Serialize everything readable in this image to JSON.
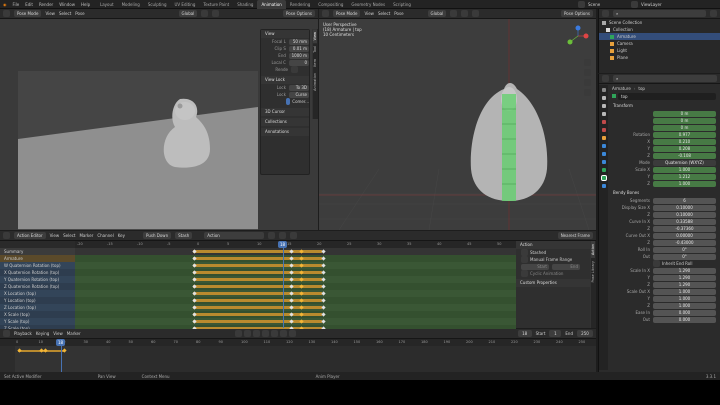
{
  "menu": [
    "File",
    "Edit",
    "Render",
    "Window",
    "Help"
  ],
  "workspaces": [
    "Layout",
    "Modeling",
    "Sculpting",
    "UV Editing",
    "Texture Paint",
    "Shading",
    "Animation",
    "Rendering",
    "Compositing",
    "Geometry Nodes",
    "Scripting"
  ],
  "active_workspace": "Animation",
  "scene": {
    "name": "Scene",
    "view_layer": "ViewLayer"
  },
  "left_view": {
    "mode": "Pose Mode",
    "view": "View",
    "select": "Select",
    "pose": "Pose",
    "global": "Global",
    "options": "Pose Options",
    "npanel": {
      "view_title": "View",
      "focal_label": "Focal L",
      "focal_value": "50 mm",
      "clip_label": "Clip S",
      "clip_value": "0.01 m",
      "end_label": "End",
      "end_value": "1000 m",
      "local_label": "Local C",
      "local_value": "0",
      "render_region": "Rende",
      "view_lock_title": "View Lock",
      "lock_label": "Lock",
      "lock_value": "To 3D",
      "lock2_label": "Lock",
      "lock2_value": "Curse",
      "comer": "Comer...",
      "cursor": "3D Cursor",
      "collections": "Collections",
      "annotations": "Annotations"
    },
    "tabs": [
      "View",
      "Tool",
      "Item",
      "Animation"
    ]
  },
  "right_view": {
    "mode": "Pose Mode",
    "view": "View",
    "select": "Select",
    "pose": "Pose",
    "global": "Global",
    "options": "Pose Options",
    "info_line1": "User Perspective",
    "info_line2": "(18) Armature | top",
    "info_line3": "10 Centimeters"
  },
  "outliner": {
    "items": [
      {
        "label": "Scene Collection",
        "kind": "root"
      },
      {
        "label": "Collection",
        "kind": "coll"
      },
      {
        "label": "Armature",
        "kind": "arm"
      },
      {
        "label": "Camera",
        "kind": "cam"
      },
      {
        "label": "Light",
        "kind": "light"
      },
      {
        "label": "Plane",
        "kind": "mesh"
      }
    ]
  },
  "properties": {
    "breadcrumb1": "Armature",
    "breadcrumb2": "top",
    "bone": "top",
    "transform": "Transform",
    "location_x": "0 m",
    "location_y": "0 m",
    "location_z": "0 m",
    "rotation_label": "Rotation",
    "rot_w": "0.977",
    "rot_x": "0.210",
    "rot_y": "0.208",
    "rot_z": "-0.108",
    "mode_label": "Mode",
    "mode_value": "Quaternion (WXYZ)",
    "scale_label": "Scale X",
    "scale_x": "1.000",
    "scale_y": "1.212",
    "scale_z": "1.000",
    "bendy": "Bendy Bones",
    "segments_label": "Segments",
    "segments": "6",
    "display_size_label": "Display Size X",
    "dsx": "0.10000",
    "dsz": "0.10000",
    "curve_in_label": "Curve In X",
    "cix": "0.33588",
    "ciz": "-0.37360",
    "curve_out_label": "Curve Out X",
    "cox": "0.00000",
    "coz": "-0.43000",
    "roll_in_label": "Roll In",
    "roll_in": "0°",
    "roll_out_label": "Out",
    "roll_out": "0°",
    "inherit": "Inherit End Roll",
    "scale_in_label": "Scale In X",
    "six": "1.290",
    "siy": "1.290",
    "siz": "1.290",
    "scale_out_label": "Scale Out X",
    "sox": "1.000",
    "soy": "1.000",
    "soz": "1.000",
    "ease_in_label": "Ease In",
    "ease_in": "0.000",
    "ease_out_label": "Out",
    "ease_out": "0.000"
  },
  "action_editor": {
    "mode": "Action Editor",
    "view": "View",
    "select": "Select",
    "marker": "Marker",
    "channel": "Channel",
    "key": "Key",
    "push_down": "Push Down",
    "stash": "Stash",
    "action_name": "Action",
    "nearest": "Nearest Frame",
    "current_frame": "18",
    "channels": [
      {
        "label": "Summary",
        "kind": "sum"
      },
      {
        "label": "Armature",
        "kind": "obj"
      },
      {
        "label": "W Quaternion Rotation (top)",
        "kind": "ch"
      },
      {
        "label": "X Quaternion Rotation (top)",
        "kind": "ch"
      },
      {
        "label": "Y Quaternion Rotation (top)",
        "kind": "ch"
      },
      {
        "label": "Z Quaternion Rotation (top)",
        "kind": "ch"
      },
      {
        "label": "X Location (top)",
        "kind": "ch"
      },
      {
        "label": "Y Location (top)",
        "kind": "ch"
      },
      {
        "label": "Z Location (top)",
        "kind": "ch"
      },
      {
        "label": "X Scale (top)",
        "kind": "ch"
      },
      {
        "label": "Y Scale (top)",
        "kind": "ch"
      },
      {
        "label": "Z Scale (top)",
        "kind": "ch"
      }
    ],
    "ruler": [
      "-20",
      "-15",
      "-10",
      "-5",
      "0",
      "5",
      "10",
      "15",
      "20",
      "25",
      "30",
      "35",
      "40",
      "45",
      "50"
    ],
    "side": {
      "title": "Action",
      "stashed": "Stashed",
      "manual": "Manual Frame Range",
      "start": "Start",
      "end": "End",
      "cyclic": "Cyclic Animation",
      "custom": "Custom Properties"
    },
    "side_tabs": [
      "Action",
      "Pose Library"
    ]
  },
  "timeline": {
    "playback": "Playback",
    "keying": "Keying",
    "view": "View",
    "marker": "Marker",
    "start_label": "Start",
    "start": "1",
    "end_label": "End",
    "end": "250",
    "frame": "18",
    "ruler": [
      "0",
      "10",
      "20",
      "30",
      "40",
      "50",
      "60",
      "70",
      "80",
      "90",
      "100",
      "110",
      "120",
      "130",
      "140",
      "150",
      "160",
      "170",
      "180",
      "190",
      "200",
      "210",
      "220",
      "230",
      "240",
      "250"
    ]
  },
  "status": {
    "s1": "Set Active Modifier",
    "s2": "Pan View",
    "s3": "Context Menu",
    "s4": "Anim Player",
    "version": "3.3.1"
  }
}
